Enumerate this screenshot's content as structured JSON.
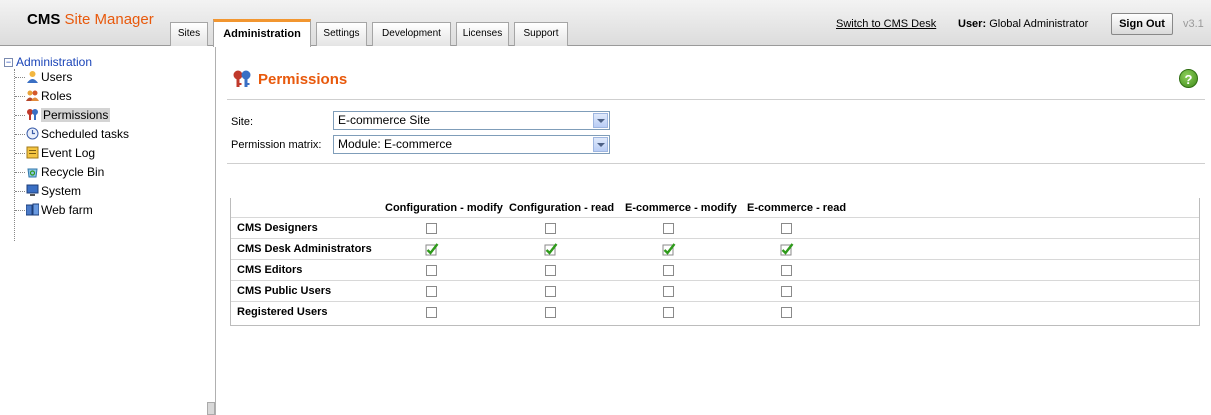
{
  "header": {
    "logo_brand": "CMS",
    "logo_product": "Site Manager",
    "tabs": [
      {
        "label": "Sites"
      },
      {
        "label": "Administration"
      },
      {
        "label": "Settings"
      },
      {
        "label": "Development"
      },
      {
        "label": "Licenses"
      },
      {
        "label": "Support"
      }
    ],
    "active_tab": "Administration",
    "switch_link": "Switch to CMS Desk",
    "user_label": "User:",
    "user_name": "Global Administrator",
    "sign_out": "Sign Out",
    "version": "v3.1"
  },
  "sidebar": {
    "root": "Administration",
    "items": [
      {
        "label": "Users",
        "icon": "users-icon"
      },
      {
        "label": "Roles",
        "icon": "roles-icon"
      },
      {
        "label": "Permissions",
        "icon": "permissions-icon"
      },
      {
        "label": "Scheduled tasks",
        "icon": "clock-icon"
      },
      {
        "label": "Event Log",
        "icon": "event-log-icon"
      },
      {
        "label": "Recycle Bin",
        "icon": "recycle-bin-icon"
      },
      {
        "label": "System",
        "icon": "computer-icon"
      },
      {
        "label": "Web farm",
        "icon": "web-farm-icon"
      }
    ],
    "selected": "Permissions"
  },
  "main": {
    "title": "Permissions",
    "site_label": "Site:",
    "site_value": "E-commerce Site",
    "matrix_label": "Permission matrix:",
    "matrix_value": "Module: E-commerce"
  },
  "matrix": {
    "columns": [
      "Configuration - modify",
      "Configuration - read",
      "E-commerce - modify",
      "E-commerce - read"
    ],
    "rows": [
      {
        "role": "CMS Designers",
        "values": [
          false,
          false,
          false,
          false
        ]
      },
      {
        "role": "CMS Desk Administrators",
        "values": [
          true,
          true,
          true,
          true
        ]
      },
      {
        "role": "CMS Editors",
        "values": [
          false,
          false,
          false,
          false
        ]
      },
      {
        "role": "CMS Public Users",
        "values": [
          false,
          false,
          false,
          false
        ]
      },
      {
        "role": "Registered Users",
        "values": [
          false,
          false,
          false,
          false
        ]
      }
    ]
  },
  "colors": {
    "accent": "#e8590c",
    "tab_active": "#f29630",
    "tree_link": "#1a44b8",
    "check": "#2e9a1a"
  }
}
